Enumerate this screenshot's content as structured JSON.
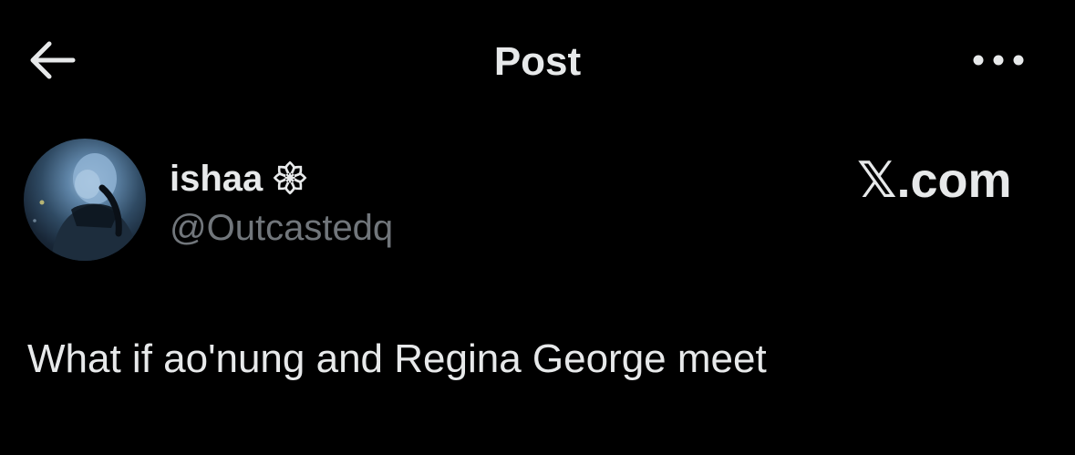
{
  "header": {
    "title": "Post",
    "back_icon": "arrow-left-icon",
    "more_icon": "more-horizontal-icon"
  },
  "author": {
    "display_name": "ishaa 𑁍",
    "handle": "@Outcastedq",
    "avatar": "avatar"
  },
  "watermark": {
    "text": "𝕏.com"
  },
  "post": {
    "text": "What if ao'nung and Regina George meet"
  },
  "colors": {
    "background": "#000000",
    "primary_text": "#e7e9ea",
    "secondary_text": "#71767b"
  }
}
